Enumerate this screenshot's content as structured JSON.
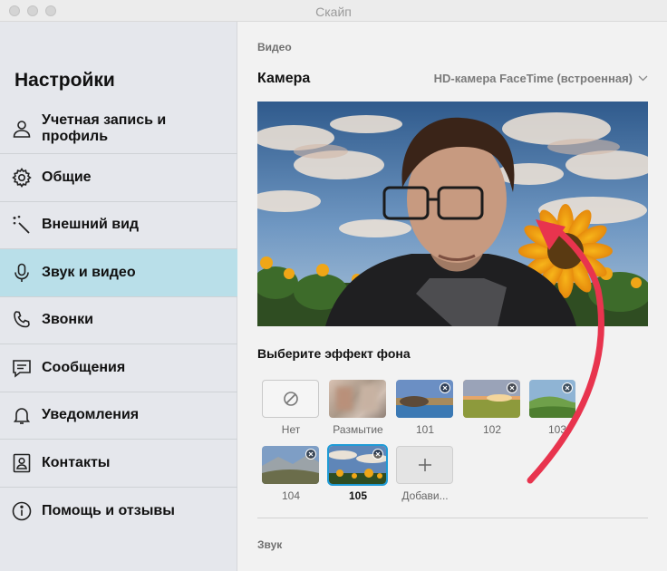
{
  "window": {
    "title": "Скайп"
  },
  "sidebar": {
    "title": "Настройки",
    "items": [
      {
        "label": "Учетная запись и профиль",
        "icon": "user-icon",
        "active": false
      },
      {
        "label": "Общие",
        "icon": "gear-icon",
        "active": false
      },
      {
        "label": "Внешний вид",
        "icon": "magic-wand-icon",
        "active": false
      },
      {
        "label": "Звук и видео",
        "icon": "microphone-icon",
        "active": true
      },
      {
        "label": "Звонки",
        "icon": "phone-icon",
        "active": false
      },
      {
        "label": "Сообщения",
        "icon": "message-icon",
        "active": false
      },
      {
        "label": "Уведомления",
        "icon": "bell-icon",
        "active": false
      },
      {
        "label": "Контакты",
        "icon": "contact-card-icon",
        "active": false
      },
      {
        "label": "Помощь и отзывы",
        "icon": "info-icon",
        "active": false
      }
    ]
  },
  "video": {
    "section_label": "Видео",
    "camera_label": "Камера",
    "camera_selected": "HD-камера FaceTime (встроенная)",
    "effects_title": "Выберите эффект фона",
    "effects": [
      {
        "label": "Нет",
        "kind": "none"
      },
      {
        "label": "Размытие",
        "kind": "blur"
      },
      {
        "label": "101",
        "kind": "image"
      },
      {
        "label": "102",
        "kind": "image"
      },
      {
        "label": "103",
        "kind": "image"
      },
      {
        "label": "104",
        "kind": "image"
      },
      {
        "label": "105",
        "kind": "image",
        "selected": true
      },
      {
        "label": "Добави...",
        "kind": "add"
      }
    ]
  },
  "audio": {
    "section_label": "Звук"
  },
  "colors": {
    "active_nav": "#b9dfe9",
    "selection": "#1f9bd6",
    "arrow": "#e8344e"
  }
}
